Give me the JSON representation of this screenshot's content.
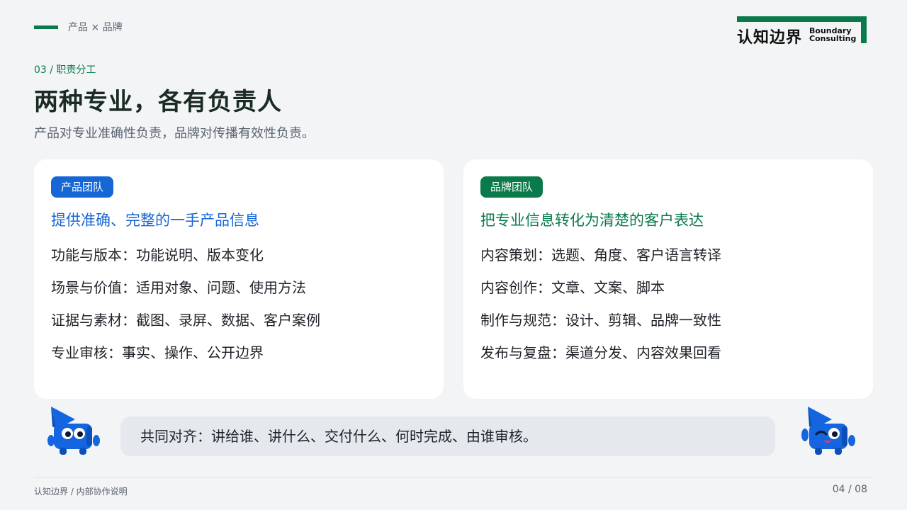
{
  "header": {
    "crumb": "产品 × 品牌",
    "logo_cn": "认知边界",
    "logo_en_line1": "Boundary",
    "logo_en_line2": "Consulting"
  },
  "section": {
    "tag": "03 / 职责分工",
    "title": "两种专业，各有负责人",
    "subtitle": "产品对专业准确性负责，品牌对传播有效性负责。"
  },
  "product_card": {
    "badge": "产品团队",
    "heading": "提供准确、完整的一手产品信息",
    "items": [
      "功能与版本：功能说明、版本变化",
      "场景与价值：适用对象、问题、使用方法",
      "证据与素材：截图、录屏、数据、客户案例",
      "专业审核：事实、操作、公开边界"
    ]
  },
  "brand_card": {
    "badge": "品牌团队",
    "heading": "把专业信息转化为清楚的客户表达",
    "items": [
      "内容策划：选题、角度、客户语言转译",
      "内容创作：文章、文案、脚本",
      "制作与规范：设计、剪辑、品牌一致性",
      "发布与复盘：渠道分发、内容效果回看"
    ]
  },
  "alignment": {
    "text": "共同对齐：讲给谁、讲什么、交付什么、何时完成、由谁审核。"
  },
  "footer": {
    "left": "认知边界  /  内部协作说明",
    "page": "04 / 08"
  },
  "colors": {
    "brand_green": "#0a7a4b",
    "product_blue": "#1666d6",
    "mascot_blue": "#1565e0"
  }
}
